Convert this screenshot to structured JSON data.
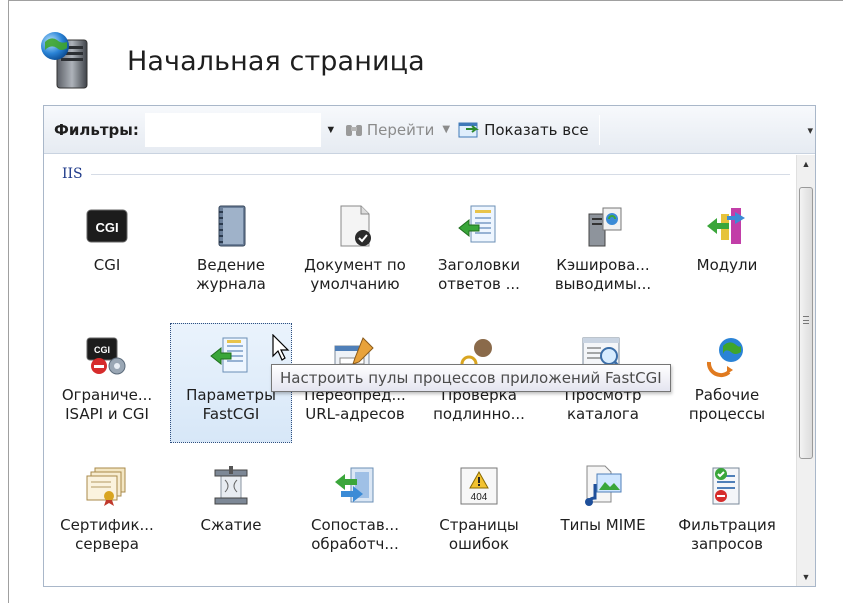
{
  "header": {
    "title": "Начальная страница",
    "icon": "server-globe-icon"
  },
  "toolbar": {
    "filters_label": "Фильтры:",
    "filter_value": "",
    "go_label": "Перейти",
    "show_all_label": "Показать все"
  },
  "group": {
    "name": "IIS"
  },
  "tiles": [
    {
      "label1": "CGI",
      "label2": "",
      "icon": "cgi-icon"
    },
    {
      "label1": "Ведение",
      "label2": "журнала",
      "icon": "logging-icon"
    },
    {
      "label1": "Документ по",
      "label2": "умолчанию",
      "icon": "default-document-icon"
    },
    {
      "label1": "Заголовки",
      "label2": "ответов ...",
      "icon": "response-headers-icon"
    },
    {
      "label1": "Кэширова...",
      "label2": "выводимы...",
      "icon": "output-caching-icon"
    },
    {
      "label1": "Модули",
      "label2": "",
      "icon": "modules-icon"
    },
    {
      "label1": "Ограниче...",
      "label2": "ISAPI и CGI",
      "icon": "isapi-cgi-restrictions-icon"
    },
    {
      "label1": "Параметры",
      "label2": "FastCGI",
      "icon": "fastcgi-settings-icon"
    },
    {
      "label1": "Переопред...",
      "label2": "URL-адресов",
      "icon": "url-rewrite-icon"
    },
    {
      "label1": "Проверка",
      "label2": "подлинно...",
      "icon": "authentication-icon"
    },
    {
      "label1": "Просмотр",
      "label2": "каталога",
      "icon": "directory-browsing-icon"
    },
    {
      "label1": "Рабочие",
      "label2": "процессы",
      "icon": "worker-processes-icon"
    },
    {
      "label1": "Сертифик...",
      "label2": "сервера",
      "icon": "server-certificates-icon"
    },
    {
      "label1": "Сжатие",
      "label2": "",
      "icon": "compression-icon"
    },
    {
      "label1": "Сопостав...",
      "label2": "обработч...",
      "icon": "handler-mappings-icon"
    },
    {
      "label1": "Страницы",
      "label2": "ошибок",
      "icon": "error-pages-icon"
    },
    {
      "label1": "Типы MIME",
      "label2": "",
      "icon": "mime-types-icon"
    },
    {
      "label1": "Фильтрация",
      "label2": "запросов",
      "icon": "request-filtering-icon"
    }
  ],
  "tooltip": {
    "text": "Настроить пулы процессов приложений FastCGI"
  },
  "error_page_badge": "404",
  "cgi_badge": "CGI"
}
